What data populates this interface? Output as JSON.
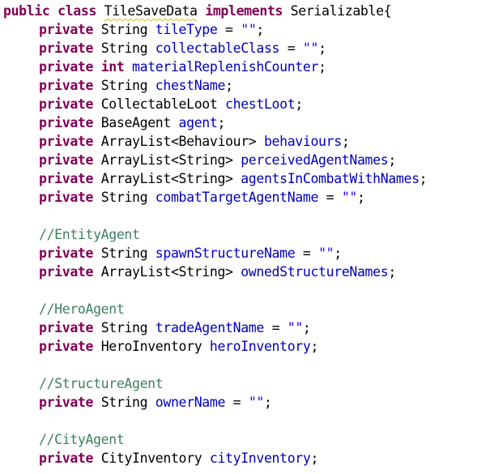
{
  "colors": {
    "keyword": "#7f0055",
    "field": "#0000c0",
    "string": "#2a00ff",
    "comment": "#3f7f5f",
    "text": "#000000",
    "warning_underline": "#d8b81a"
  },
  "code": {
    "class_decl": {
      "kw_public": "public",
      "kw_class": "class",
      "class_name": "TileSaveData",
      "kw_implements": "implements",
      "interface": "Serializable{"
    },
    "fields": [
      {
        "kw": "private",
        "type": "String",
        "name": "tileType",
        "rest": " = ",
        "value": "\"\"",
        "end": ";"
      },
      {
        "kw": "private",
        "type": "String",
        "name": "collectableClass",
        "rest": " = ",
        "value": "\"\"",
        "end": ";"
      },
      {
        "kw": "private",
        "type_kw": "int",
        "name": "materialReplenishCounter",
        "end": ";"
      },
      {
        "kw": "private",
        "type": "String",
        "name": "chestName",
        "end": ";"
      },
      {
        "kw": "private",
        "type": "CollectableLoot",
        "name": "chestLoot",
        "end": ";"
      },
      {
        "kw": "private",
        "type": "BaseAgent",
        "name": "agent",
        "end": ";"
      },
      {
        "kw": "private",
        "type": "ArrayList<Behaviour>",
        "name": "behaviours",
        "end": ";"
      },
      {
        "kw": "private",
        "type": "ArrayList<String>",
        "name": "perceivedAgentNames",
        "end": ";"
      },
      {
        "kw": "private",
        "type": "ArrayList<String>",
        "name": "agentsInCombatWithNames",
        "end": ";"
      },
      {
        "kw": "private",
        "type": "String",
        "name": "combatTargetAgentName",
        "rest": " = ",
        "value": "\"\"",
        "end": ";"
      }
    ],
    "entity_section": {
      "comment": "//EntityAgent",
      "fields": [
        {
          "kw": "private",
          "type": "String",
          "name": "spawnStructureName",
          "rest": " = ",
          "value": "\"\"",
          "end": ";"
        },
        {
          "kw": "private",
          "type": "ArrayList<String>",
          "name": "ownedStructureNames",
          "end": ";"
        }
      ]
    },
    "hero_section": {
      "comment": "//HeroAgent",
      "fields": [
        {
          "kw": "private",
          "type": "String",
          "name": "tradeAgentName",
          "rest": " = ",
          "value": "\"\"",
          "end": ";"
        },
        {
          "kw": "private",
          "type": "HeroInventory",
          "name": "heroInventory",
          "end": ";"
        }
      ]
    },
    "structure_section": {
      "comment": "//StructureAgent",
      "fields": [
        {
          "kw": "private",
          "type": "String",
          "name": "ownerName",
          "rest": " = ",
          "value": "\"\"",
          "end": ";"
        }
      ]
    },
    "city_section": {
      "comment": "//CityAgent",
      "fields": [
        {
          "kw": "private",
          "type": "CityInventory",
          "name": "cityInventory",
          "end": ";"
        }
      ]
    }
  }
}
